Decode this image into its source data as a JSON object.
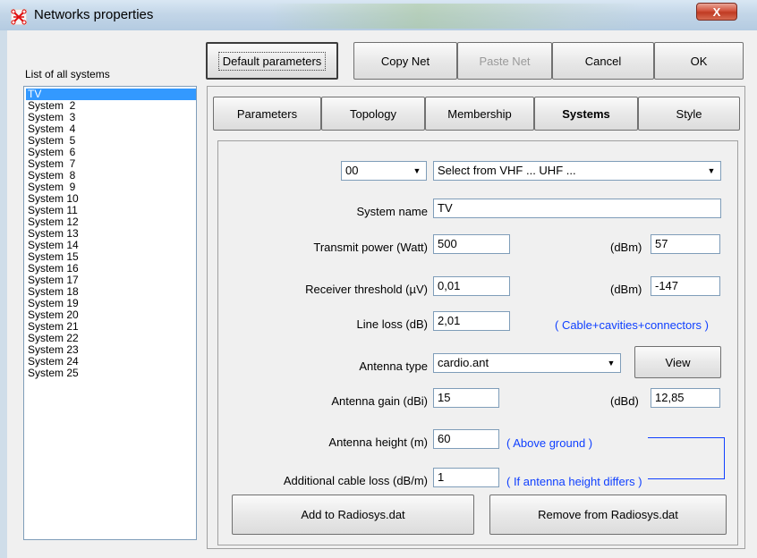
{
  "window": {
    "title": "Networks properties",
    "close_label": "X"
  },
  "toolbar": {
    "default_params": "Default parameters",
    "copy_net": "Copy Net",
    "paste_net": "Paste Net",
    "cancel": "Cancel",
    "ok": "OK"
  },
  "systems_list": {
    "label": "List of all systems",
    "items": [
      "TV",
      "System  2",
      "System  3",
      "System  4",
      "System  5",
      "System  6",
      "System  7",
      "System  8",
      "System  9",
      "System 10",
      "System 11",
      "System 12",
      "System 13",
      "System 14",
      "System 15",
      "System 16",
      "System 17",
      "System 18",
      "System 19",
      "System 20",
      "System 21",
      "System 22",
      "System 23",
      "System 24",
      "System 25"
    ],
    "selected": "TV"
  },
  "tabs": [
    "Parameters",
    "Topology",
    "Membership",
    "Systems",
    "Style"
  ],
  "active_tab": "Systems",
  "form": {
    "number_select": "00",
    "band_select": "Select from VHF ... UHF ...",
    "system_name_label": "System name",
    "system_name": "TV",
    "transmit_power_label": "Transmit power (Watt)",
    "transmit_power": "500",
    "transmit_dbm_label": "(dBm)",
    "transmit_dbm": "57",
    "receiver_threshold_label": "Receiver threshold (µV)",
    "receiver_threshold": "0,01",
    "receiver_dbm_label": "(dBm)",
    "receiver_dbm": "-147",
    "line_loss_label": "Line loss (dB)",
    "line_loss": "2,01",
    "line_loss_note": "( Cable+cavities+connectors )",
    "antenna_type_label": "Antenna type",
    "antenna_type": "cardio.ant",
    "view_button": "View",
    "antenna_gain_label": "Antenna gain (dBi)",
    "antenna_gain": "15",
    "antenna_dbd_label": "(dBd)",
    "antenna_dbd": "12,85",
    "antenna_height_label": "Antenna height (m)",
    "antenna_height": "60",
    "antenna_height_note": "( Above ground )",
    "cable_loss_label": "Additional cable loss (dB/m)",
    "cable_loss": "1",
    "cable_loss_note": "( If antenna height differs )",
    "add_button": "Add to Radiosys.dat",
    "remove_button": "Remove from Radiosys.dat"
  },
  "colors": {
    "selection": "#3399ff",
    "note_blue": "#1040ff"
  }
}
